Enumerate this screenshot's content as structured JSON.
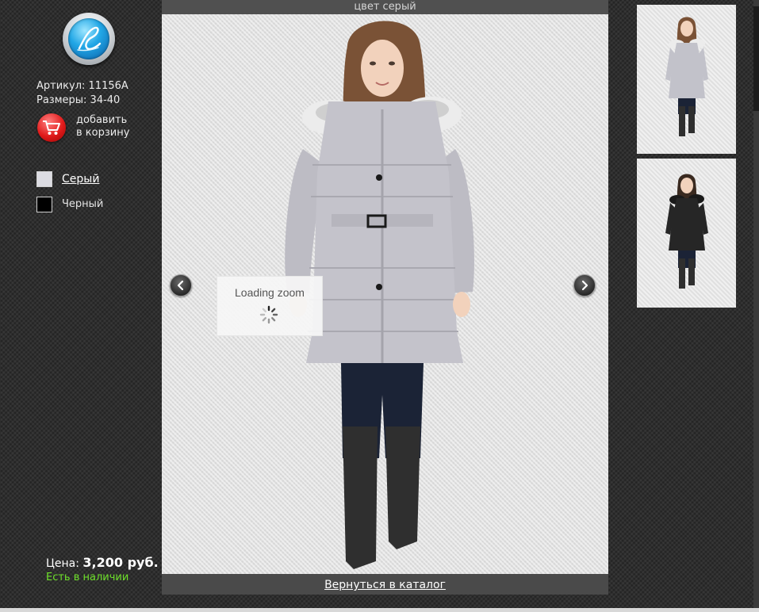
{
  "product": {
    "sku_label": "Артикул: 11156A",
    "sizes_label": "Размеры: 34-40",
    "add_to_cart_line1": "добавить",
    "add_to_cart_line2": "в корзину"
  },
  "colors": [
    {
      "label": "Серый",
      "swatch": "#dcdce2",
      "selected": true
    },
    {
      "label": "Черный",
      "swatch": "#000000",
      "selected": false
    }
  ],
  "viewer": {
    "title": "цвет серый",
    "loading_text": "Loading zoom",
    "back_link": "Вернуться в каталог"
  },
  "price": {
    "label": "Цена:",
    "value": "3,200 руб.",
    "availability": "Есть в наличии",
    "availability_color": "#6ee02a"
  },
  "icons": {
    "logo": "logo-icon",
    "cart": "shopping-cart-icon",
    "prev": "chevron-left-icon",
    "next": "chevron-right-icon",
    "spinner": "spinner-icon"
  },
  "thumbnails": [
    {
      "name": "thumbnail-grey-coat",
      "coat_color": "#c2c2ca"
    },
    {
      "name": "thumbnail-black-coat",
      "coat_color": "#262626"
    }
  ]
}
